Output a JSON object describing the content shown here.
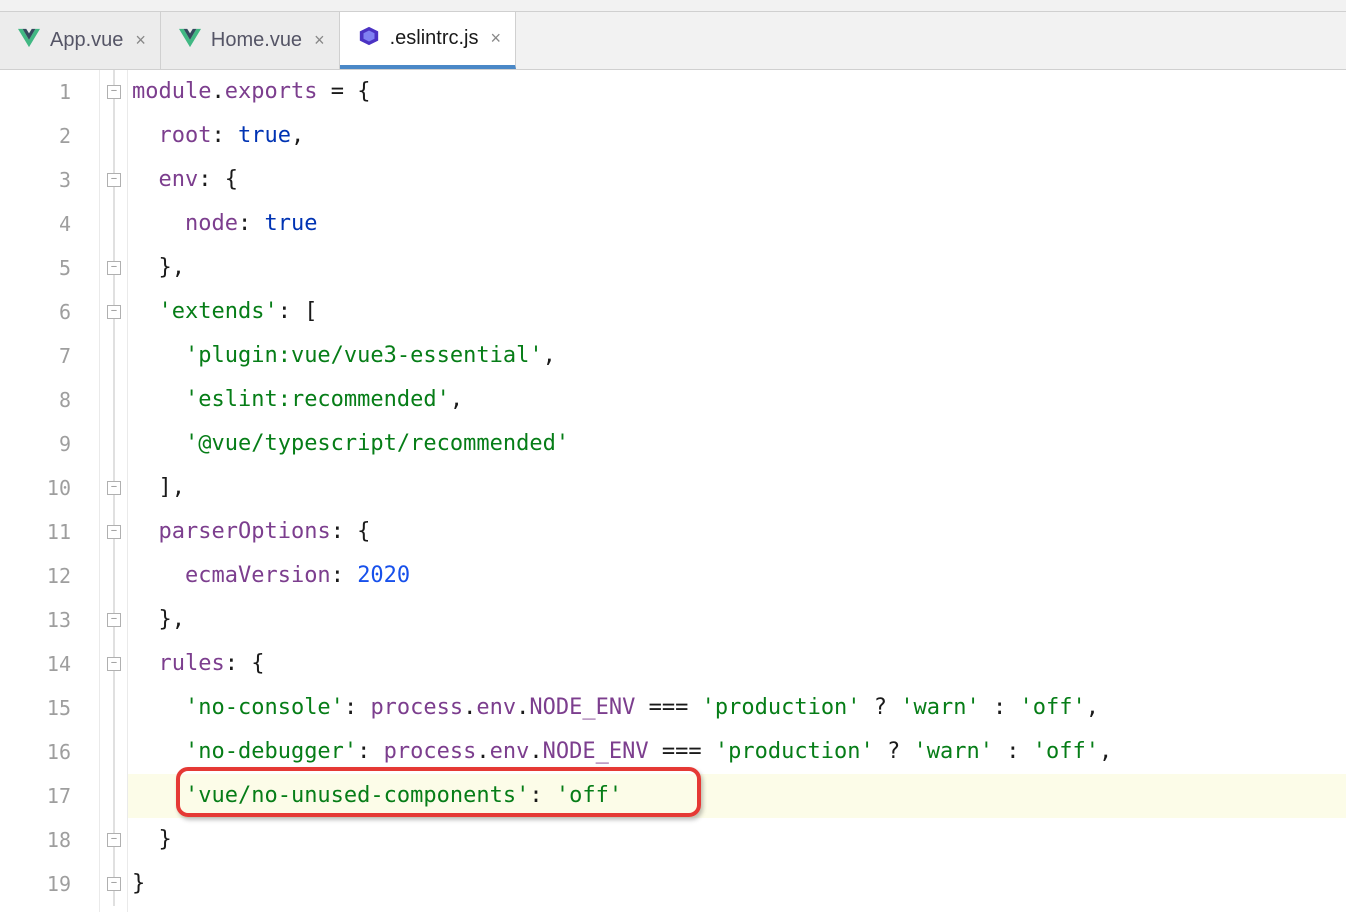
{
  "tabs": [
    {
      "label": "App.vue",
      "active": false,
      "kind": "vue"
    },
    {
      "label": "Home.vue",
      "active": false,
      "kind": "vue"
    },
    {
      "label": ".eslintrc.js",
      "active": true,
      "kind": "eslint"
    }
  ],
  "code": {
    "l1": {
      "a": "module",
      "b": ".",
      "c": "exports",
      "d": " = {"
    },
    "l2": {
      "a": "  ",
      "b": "root",
      "c": ": ",
      "d": "true",
      "e": ","
    },
    "l3": {
      "a": "  ",
      "b": "env",
      "c": ": {"
    },
    "l4": {
      "a": "    ",
      "b": "node",
      "c": ": ",
      "d": "true"
    },
    "l5": {
      "a": "  },"
    },
    "l6": {
      "a": "  ",
      "b": "'extends'",
      "c": ": ["
    },
    "l7": {
      "a": "    ",
      "b": "'plugin:vue/vue3-essential'",
      "c": ","
    },
    "l8": {
      "a": "    ",
      "b": "'eslint:recommended'",
      "c": ","
    },
    "l9": {
      "a": "    ",
      "b": "'@vue/typescript/recommended'"
    },
    "l10": {
      "a": "  ],"
    },
    "l11": {
      "a": "  ",
      "b": "parserOptions",
      "c": ": {"
    },
    "l12": {
      "a": "    ",
      "b": "ecmaVersion",
      "c": ": ",
      "d": "2020"
    },
    "l13": {
      "a": "  },"
    },
    "l14": {
      "a": "  ",
      "b": "rules",
      "c": ": {"
    },
    "l15": {
      "a": "    ",
      "b": "'no-console'",
      "c": ": ",
      "d": "process",
      "e": ".",
      "f": "env",
      "g": ".",
      "h": "NODE_ENV",
      "i": " === ",
      "j": "'production'",
      "k": " ? ",
      "l": "'warn'",
      "m": " : ",
      "n": "'off'",
      "o": ","
    },
    "l16": {
      "a": "    ",
      "b": "'no-debugger'",
      "c": ": ",
      "d": "process",
      "e": ".",
      "f": "env",
      "g": ".",
      "h": "NODE_ENV",
      "i": " === ",
      "j": "'production'",
      "k": " ? ",
      "l": "'warn'",
      "m": " : ",
      "n": "'off'",
      "o": ","
    },
    "l17": {
      "a": "    ",
      "b": "'vue/no-unused-components'",
      "c": ": ",
      "d": "'off'"
    },
    "l18": {
      "a": "  }"
    },
    "l19": {
      "a": "}"
    }
  },
  "line_numbers": [
    "1",
    "2",
    "3",
    "4",
    "5",
    "6",
    "7",
    "8",
    "9",
    "10",
    "11",
    "12",
    "13",
    "14",
    "15",
    "16",
    "17",
    "18",
    "19"
  ]
}
